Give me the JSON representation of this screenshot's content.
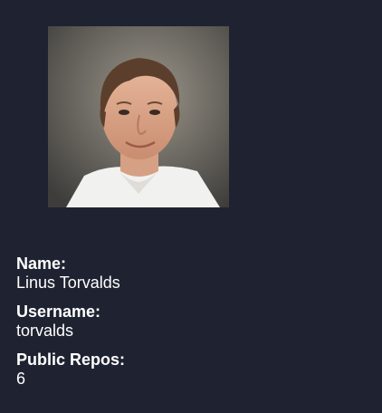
{
  "profile": {
    "avatar_alt": "Linus Torvalds",
    "fields": [
      {
        "label": "Name:",
        "value": "Linus Torvalds"
      },
      {
        "label": "Username:",
        "value": "torvalds"
      },
      {
        "label": "Public Repos:",
        "value": "6"
      }
    ]
  }
}
